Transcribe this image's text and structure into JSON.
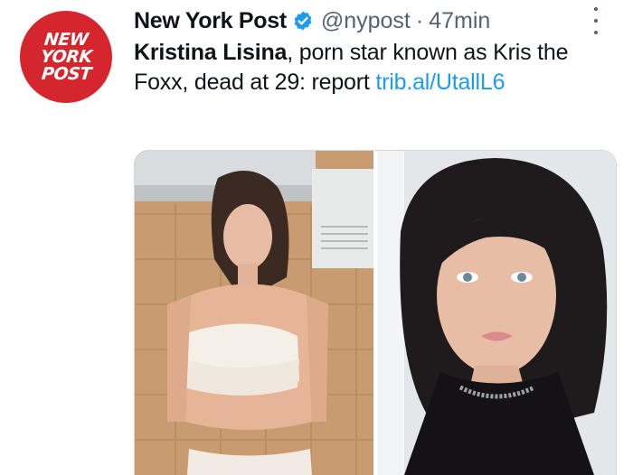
{
  "tweet": {
    "author_name": "New York Post",
    "handle": "@nypost",
    "separator": "·",
    "time": "47min",
    "text_bold": "Kristina Lisina",
    "text_rest": ", porn star known as Kris the Foxx, dead at 29: report ",
    "link": "trib.al/UtallL6",
    "avatar_lines": [
      "NEW",
      "YORK",
      "POST"
    ]
  },
  "icons": {
    "verified": "verified-badge-icon",
    "more": "more-options-icon"
  },
  "colors": {
    "brand_red": "#d6262d",
    "link_blue": "#1d9bf0",
    "verified_blue": "#1d9bf0"
  }
}
